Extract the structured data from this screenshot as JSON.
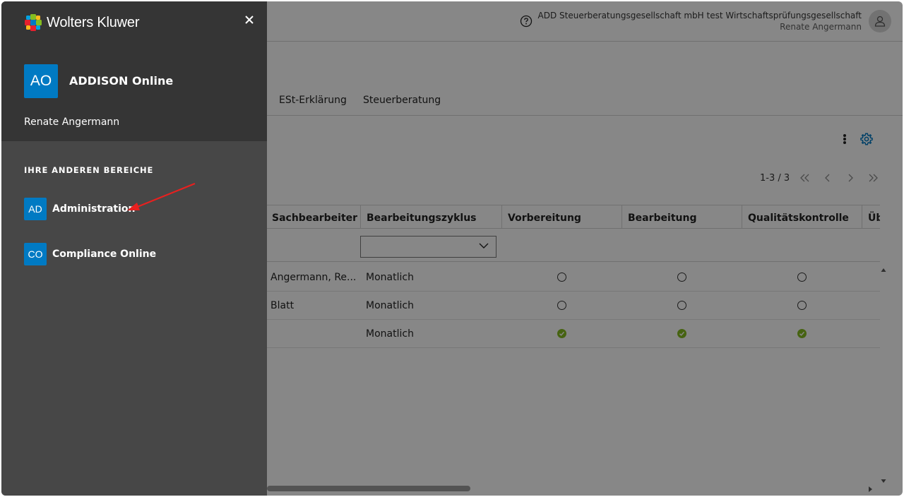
{
  "header": {
    "company": "ADD Steuerberatungsgesellschaft mbH test Wirtschaftsprüfungsgesellschaft",
    "user": "Renate Angermann"
  },
  "tabs": [
    "ESt-Erklärung",
    "Steuerberatung"
  ],
  "pagination": {
    "range": "1-3 / 3"
  },
  "table": {
    "columns": [
      "Sachbearbeiter",
      "Bearbeitungszyklus",
      "Vorbereitung",
      "Bearbeitung",
      "Qualitätskontrolle",
      "Üb"
    ],
    "rows": [
      {
        "sachbearbeiter": "Angermann, Re...",
        "zyklus": "Monatlich",
        "vorbereitung": "open",
        "bearbeitung": "open",
        "qualitaet": "open"
      },
      {
        "sachbearbeiter": "Blatt",
        "zyklus": "Monatlich",
        "vorbereitung": "open",
        "bearbeitung": "open",
        "qualitaet": "open"
      },
      {
        "sachbearbeiter": "",
        "zyklus": "Monatlich",
        "vorbereitung": "done",
        "bearbeitung": "done",
        "qualitaet": "done"
      }
    ]
  },
  "drawer": {
    "logo_text": "Wolters Kluwer",
    "app_initials": "AO",
    "app_name": "ADDISON Online",
    "user": "Renate Angermann",
    "section_title": "IHRE ANDEREN BEREICHE",
    "areas": [
      {
        "initials": "AD",
        "label": "Administration"
      },
      {
        "initials": "CO",
        "label": "Compliance Online"
      }
    ]
  },
  "colors": {
    "accent": "#007ac3",
    "success": "#85bc20",
    "drawer": "#474747",
    "drawer_header": "#353535",
    "annotation_arrow": "#e8201f"
  },
  "icons": [
    "help-icon",
    "avatar-icon",
    "kebab-menu-icon",
    "gear-icon",
    "first-page-icon",
    "prev-page-icon",
    "next-page-icon",
    "last-page-icon",
    "close-icon",
    "chevron-down-icon"
  ]
}
